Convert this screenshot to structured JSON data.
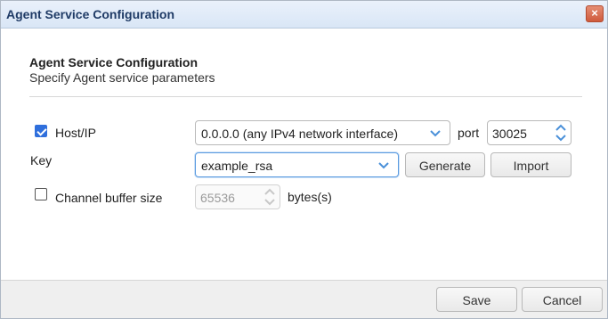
{
  "window": {
    "title": "Agent Service Configuration",
    "close_label": "×"
  },
  "section": {
    "title": "Agent Service Configuration",
    "subtitle": "Specify Agent service parameters"
  },
  "host": {
    "label": "Host/IP",
    "checked": true,
    "selected": "0.0.0.0 (any IPv4 network interface)",
    "port_label": "port",
    "port_value": "30025"
  },
  "key": {
    "label": "Key",
    "selected": "example_rsa",
    "generate_label": "Generate",
    "import_label": "Import"
  },
  "buffer": {
    "label": "Channel buffer size",
    "checked": false,
    "value": "65536",
    "unit": "bytes(s)"
  },
  "footer": {
    "save_label": "Save",
    "cancel_label": "Cancel"
  },
  "colors": {
    "accent": "#2f6fdc",
    "title_text": "#1f3b66",
    "close": "#cf5a3c"
  }
}
